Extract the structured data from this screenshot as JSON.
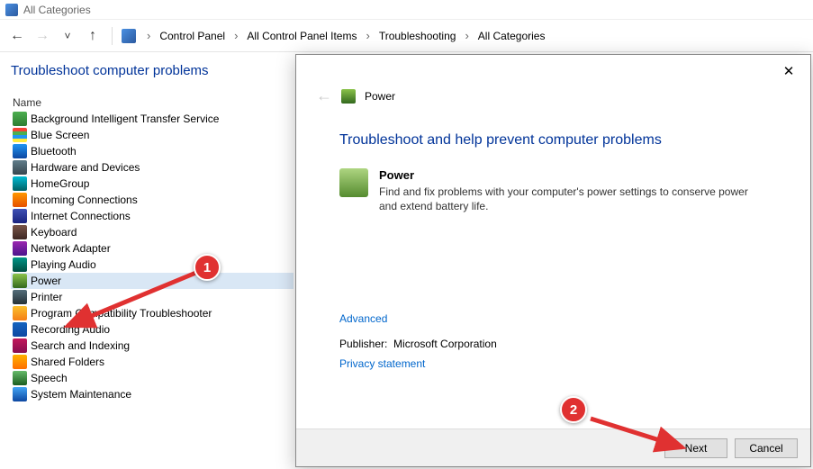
{
  "window": {
    "title": "All Categories"
  },
  "breadcrumbs": {
    "b0": "Control Panel",
    "b1": "All Control Panel Items",
    "b2": "Troubleshooting",
    "b3": "All Categories"
  },
  "left": {
    "header": "Troubleshoot computer problems",
    "column": "Name",
    "items": {
      "i0": "Background Intelligent Transfer Service",
      "i1": "Blue Screen",
      "i2": "Bluetooth",
      "i3": "Hardware and Devices",
      "i4": "HomeGroup",
      "i5": "Incoming Connections",
      "i6": "Internet Connections",
      "i7": "Keyboard",
      "i8": "Network Adapter",
      "i9": "Playing Audio",
      "i10": "Power",
      "i11": "Printer",
      "i12": "Program Compatibility Troubleshooter",
      "i13": "Recording Audio",
      "i14": "Search and Indexing",
      "i15": "Shared Folders",
      "i16": "Speech",
      "i17": "System Maintenance"
    }
  },
  "dialog": {
    "troubleshooter": "Power",
    "heading": "Troubleshoot and help prevent computer problems",
    "section_title": "Power",
    "section_desc": "Find and fix problems with your computer's power settings to conserve power and extend battery life.",
    "advanced": "Advanced",
    "publisher_label": "Publisher:",
    "publisher_value": "Microsoft Corporation",
    "privacy": "Privacy statement",
    "next": "Next",
    "cancel": "Cancel"
  },
  "annotations": {
    "b1": "1",
    "b2": "2"
  }
}
